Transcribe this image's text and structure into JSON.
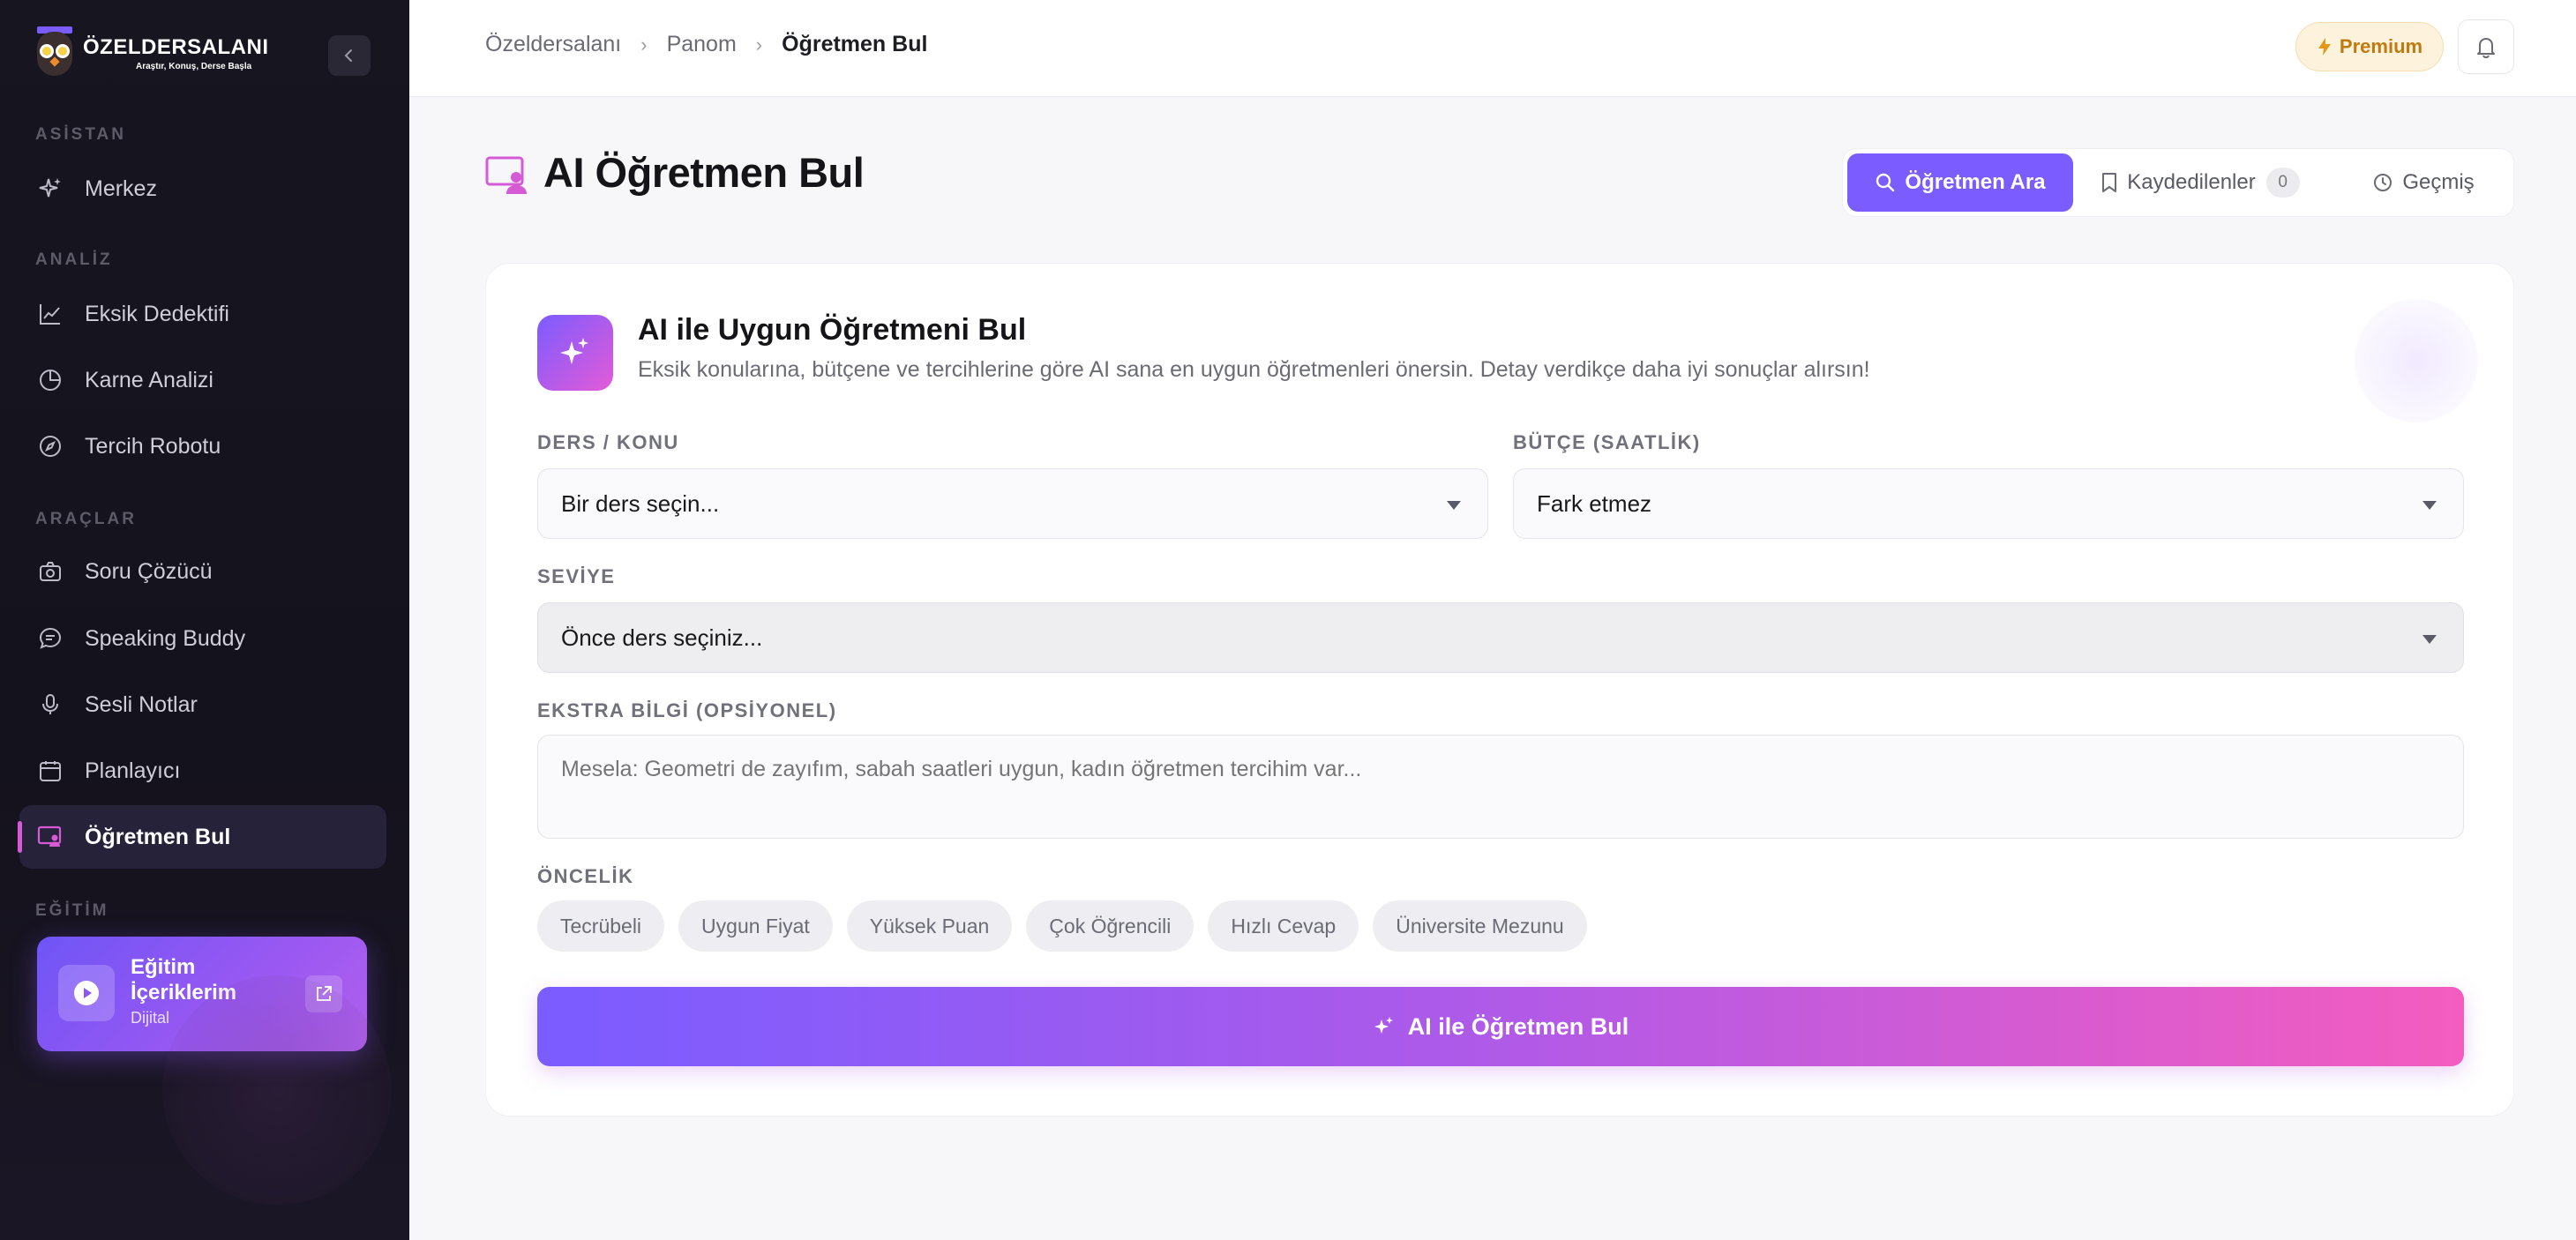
{
  "app": {
    "logo_title": "ÖZELDERSALANI",
    "logo_sub": "Araştır, Konuş, Derse Başla"
  },
  "sidebar": {
    "sections": {
      "asistan": "ASİSTAN",
      "analiz": "ANALİZ",
      "araclar": "ARAÇLAR",
      "egitim": "EĞİTİM"
    },
    "items": [
      {
        "label": "Merkez",
        "icon": "sparkle-icon"
      },
      {
        "label": "Eksik Dedektifi",
        "icon": "trend-chart-icon"
      },
      {
        "label": "Karne Analizi",
        "icon": "pie-chart-icon"
      },
      {
        "label": "Tercih Robotu",
        "icon": "compass-icon"
      },
      {
        "label": "Soru Çözücü",
        "icon": "camera-icon"
      },
      {
        "label": "Speaking Buddy",
        "icon": "chat-bubble-icon"
      },
      {
        "label": "Sesli Notlar",
        "icon": "microphone-icon"
      },
      {
        "label": "Planlayıcı",
        "icon": "calendar-icon"
      },
      {
        "label": "Öğretmen Bul",
        "icon": "teacher-board-icon"
      }
    ],
    "active_item": "Öğretmen Bul",
    "edu_card": {
      "title": "Eğitim İçeriklerim",
      "subtitle": "Dijital"
    }
  },
  "topbar": {
    "breadcrumb": [
      "Özeldersalanı",
      "Panom",
      "Öğretmen Bul"
    ],
    "premium_label": "Premium"
  },
  "page": {
    "title": "AI Öğretmen Bul",
    "tabs": [
      {
        "label": "Öğretmen Ara",
        "active": true
      },
      {
        "label": "Kaydedilenler",
        "count": "0"
      },
      {
        "label": "Geçmiş"
      }
    ]
  },
  "card": {
    "title": "AI ile Uygun Öğretmeni Bul",
    "description": "Eksik konularına, bütçene ve tercihlerine göre AI sana en uygun öğretmenleri önersin. Detay verdikçe daha iyi sonuçlar alırsın!",
    "fields": {
      "subject_label": "DERS / KONU",
      "subject_value": "Bir ders seçin...",
      "budget_label": "BÜTÇE (SAATLİK)",
      "budget_value": "Fark etmez",
      "level_label": "SEVİYE",
      "level_value": "Önce ders seçiniz...",
      "extra_label": "EKSTRA BİLGİ (OPSİYONEL)",
      "extra_placeholder": "Mesela: Geometri de zayıfım, sabah saatleri uygun, kadın öğretmen tercihim var...",
      "priority_label": "ÖNCELİK"
    },
    "priorities": [
      "Tecrübeli",
      "Uygun Fiyat",
      "Yüksek Puan",
      "Çok Öğrencili",
      "Hızlı Cevap",
      "Üniversite Mezunu"
    ],
    "cta_label": "AI ile Öğretmen Bul"
  },
  "colors": {
    "accent": "#7a5cff",
    "accent_pink": "#f45cbf",
    "premium": "#c07a10",
    "sidebar_bg": "#17151f"
  }
}
